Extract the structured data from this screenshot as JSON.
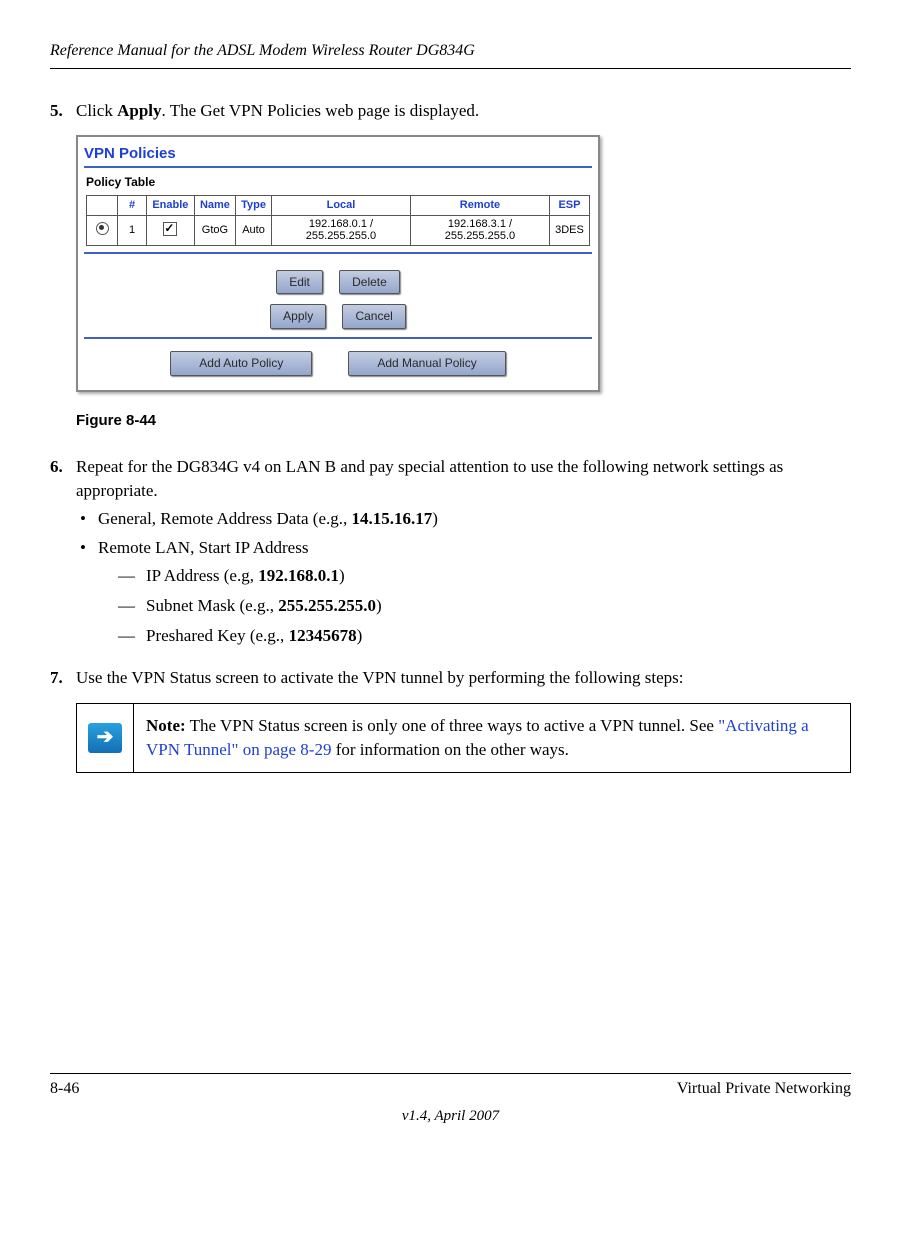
{
  "header": "Reference Manual for the ADSL Modem Wireless Router DG834G",
  "step5": {
    "num": "5.",
    "prefix": "Click ",
    "bold": "Apply",
    "suffix": ". The Get VPN Policies web page is displayed."
  },
  "figure": {
    "title": "VPN Policies",
    "subtitle": "Policy Table",
    "headers": {
      "blank": "",
      "num": "#",
      "enable": "Enable",
      "name": "Name",
      "type": "Type",
      "local": "Local",
      "remote": "Remote",
      "esp": "ESP"
    },
    "row": {
      "num": "1",
      "name": "GtoG",
      "type": "Auto",
      "local": "192.168.0.1 /\n255.255.255.0",
      "remote": "192.168.3.1 /\n255.255.255.0",
      "esp": "3DES"
    },
    "buttons": {
      "edit": "Edit",
      "delete": "Delete",
      "apply": "Apply",
      "cancel": "Cancel",
      "addAuto": "Add Auto Policy",
      "addManual": "Add Manual Policy"
    }
  },
  "figure_caption": "Figure 8-44",
  "step6": {
    "num": "6.",
    "text": "Repeat for the DG834G v4 on LAN B and pay special attention to use the following network settings as appropriate.",
    "bullet1": {
      "pre": "General, Remote Address Data (e.g., ",
      "bold": "14.15.16.17",
      "post": ")"
    },
    "bullet2": "Remote LAN, Start IP Address",
    "dash1": {
      "pre": "IP Address (e.g, ",
      "bold": "192.168.0.1",
      "post": ")"
    },
    "dash2": {
      "pre": "Subnet Mask (e.g., ",
      "bold": "255.255.255.0",
      "post": ")"
    },
    "dash3": {
      "pre": "Preshared Key (e.g., ",
      "bold": "12345678",
      "post": ")"
    }
  },
  "step7": {
    "num": "7.",
    "text": "Use the VPN Status screen to activate the VPN tunnel by performing the following steps:"
  },
  "note": {
    "lead": "Note:",
    "body1": " The VPN Status screen is only one of three ways to active a VPN tunnel. See ",
    "link": "\"Activating a VPN Tunnel\" on page 8-29",
    "body2": " for information on the other ways."
  },
  "footer": {
    "left": "8-46",
    "right": "Virtual Private Networking",
    "center": "v1.4, April 2007"
  }
}
